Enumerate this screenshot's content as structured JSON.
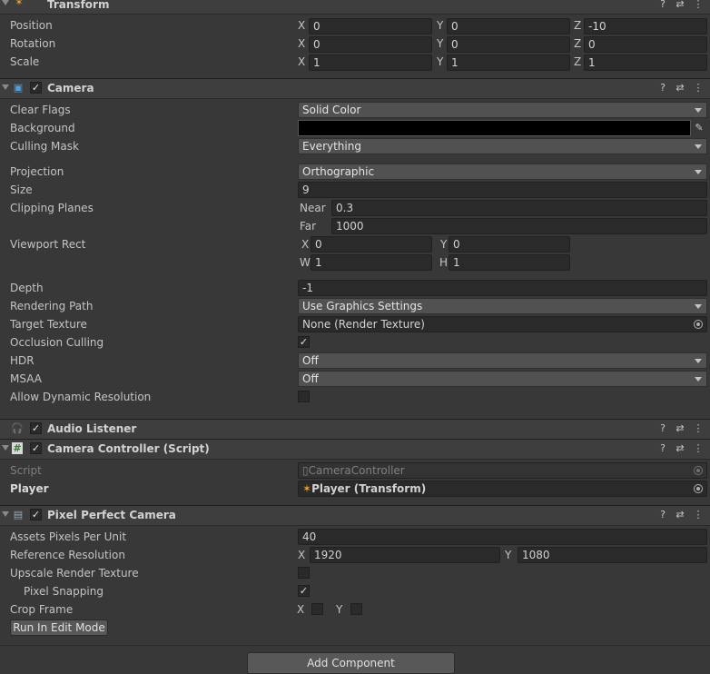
{
  "transform": {
    "title": "Transform",
    "position_label": "Position",
    "rotation_label": "Rotation",
    "scale_label": "Scale",
    "axis_x": "X",
    "axis_y": "Y",
    "axis_z": "Z",
    "position": {
      "x": "0",
      "y": "0",
      "z": "-10"
    },
    "rotation": {
      "x": "0",
      "y": "0",
      "z": "0"
    },
    "scale": {
      "x": "1",
      "y": "1",
      "z": "1"
    }
  },
  "camera": {
    "title": "Camera",
    "clear_flags_label": "Clear Flags",
    "clear_flags": "Solid Color",
    "background_label": "Background",
    "background_color": "#000000",
    "culling_mask_label": "Culling Mask",
    "culling_mask": "Everything",
    "projection_label": "Projection",
    "projection": "Orthographic",
    "size_label": "Size",
    "size": "9",
    "clipping_label": "Clipping Planes",
    "near_label": "Near",
    "near": "0.3",
    "far_label": "Far",
    "far": "1000",
    "viewport_label": "Viewport Rect",
    "vx_label": "X",
    "vx": "0",
    "vy_label": "Y",
    "vy": "0",
    "vw_label": "W",
    "vw": "1",
    "vh_label": "H",
    "vh": "1",
    "depth_label": "Depth",
    "depth": "-1",
    "rendering_path_label": "Rendering Path",
    "rendering_path": "Use Graphics Settings",
    "target_texture_label": "Target Texture",
    "target_texture": "None (Render Texture)",
    "occlusion_label": "Occlusion Culling",
    "occlusion_checked": true,
    "hdr_label": "HDR",
    "hdr": "Off",
    "msaa_label": "MSAA",
    "msaa": "Off",
    "dynres_label": "Allow Dynamic Resolution",
    "dynres_checked": false
  },
  "audio_listener": {
    "title": "Audio Listener"
  },
  "camera_controller": {
    "title": "Camera Controller (Script)",
    "script_label": "Script",
    "script": "CameraController",
    "player_label": "Player",
    "player": "Player (Transform)"
  },
  "pixel_perfect": {
    "title": "Pixel Perfect Camera",
    "ppu_label": "Assets Pixels Per Unit",
    "ppu": "40",
    "refres_label": "Reference Resolution",
    "ref_x_label": "X",
    "ref_x": "1920",
    "ref_y_label": "Y",
    "ref_y": "1080",
    "upscale_label": "Upscale Render Texture",
    "snapping_label": "Pixel Snapping",
    "crop_label": "Crop Frame",
    "crop_x_label": "X",
    "crop_y_label": "Y",
    "run_button": "Run In Edit Mode"
  },
  "add_component": "Add Component",
  "checkmark": "✓"
}
